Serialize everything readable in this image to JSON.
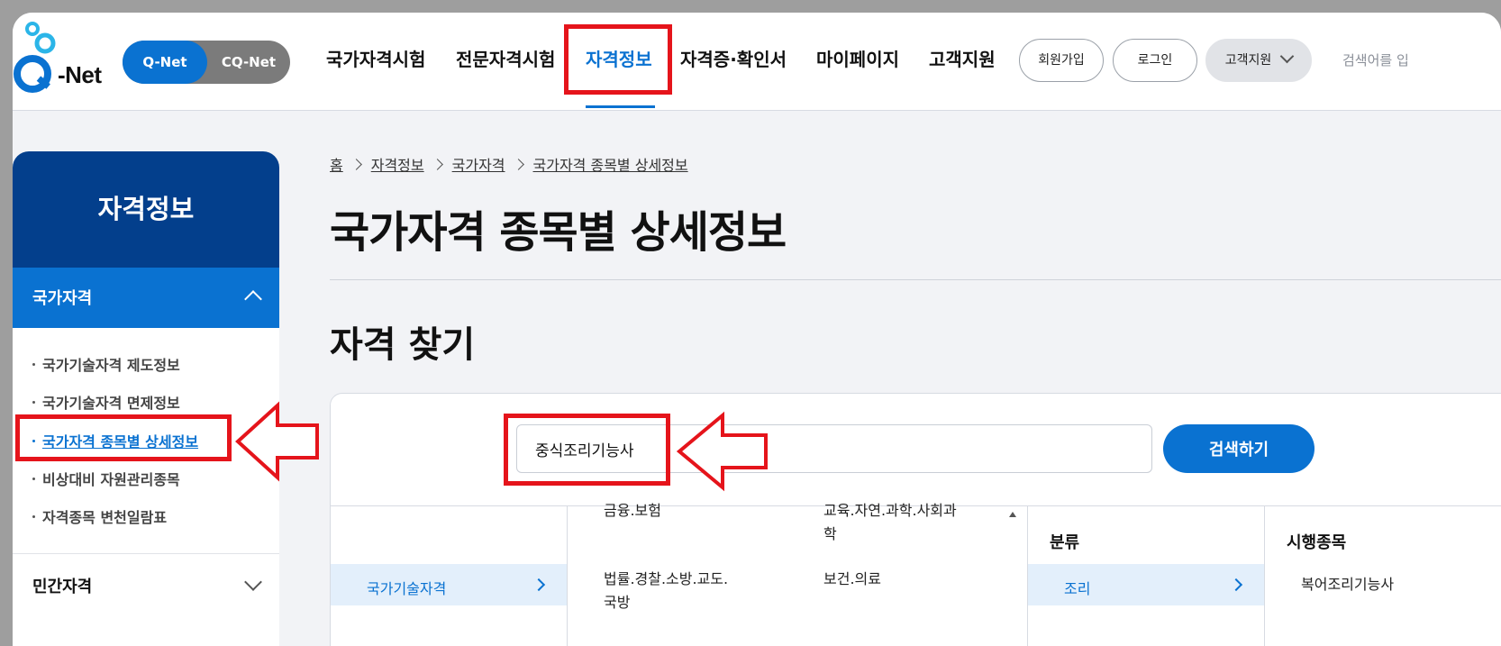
{
  "header": {
    "logo_text": "-Net",
    "toggle": {
      "active": "Q-Net",
      "inactive": "CQ-Net"
    },
    "nav": [
      "국가자격시험",
      "전문자격시험",
      "자격정보",
      "자격증·확인서",
      "마이페이지",
      "고객지원"
    ],
    "active_nav": "자격정보",
    "signup": "회원가입",
    "login": "로그인",
    "support_dropdown": "고객지원",
    "search_placeholder": "검색어를 입"
  },
  "sidebar": {
    "title": "자격정보",
    "section": "국가자격",
    "items": [
      "국가기술자격 제도정보",
      "국가기술자격 면제정보",
      "국가자격 종목별 상세정보",
      "비상대비 자원관리종목",
      "자격종목 변천일람표"
    ],
    "section2": "민간자격"
  },
  "breadcrumb": [
    "홈",
    "자격정보",
    "국가자격",
    "국가자격 종목별 상세정보"
  ],
  "page_title": "국가자격 종목별 상세정보",
  "section_title": "자격 찾기",
  "search": {
    "value": "중식조리기능사",
    "button": "검색하기"
  },
  "categories": {
    "col1": {
      "selected": "국가기술자격"
    },
    "col2": {
      "left": [
        "금융.보험",
        "법률.경찰.소방.교도.",
        "국방"
      ],
      "right": [
        "교육.자연.과학.사회과",
        "학",
        "보건.의료"
      ]
    },
    "col3": {
      "header": "분류",
      "selected": "조리"
    },
    "col4": {
      "header": "시행종목",
      "item": "복어조리기능사"
    }
  },
  "colors": {
    "primary": "#0a72d1",
    "navy": "#033f8c",
    "annotation": "#e5141b"
  }
}
